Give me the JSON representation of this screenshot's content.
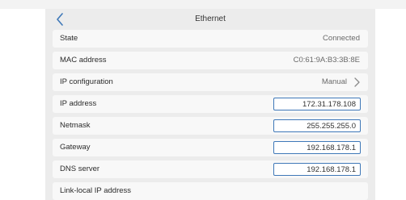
{
  "header": {
    "title": "Ethernet"
  },
  "rows": {
    "state": {
      "label": "State",
      "value": "Connected"
    },
    "mac": {
      "label": "MAC address",
      "value": "C0:61:9A:B3:3B:8E"
    },
    "ipconfig": {
      "label": "IP configuration",
      "value": "Manual"
    },
    "ip": {
      "label": "IP address",
      "value": "172.31.178.108"
    },
    "netmask": {
      "label": "Netmask",
      "value": "255.255.255.0"
    },
    "gateway": {
      "label": "Gateway",
      "value": "192.168.178.1"
    },
    "dns": {
      "label": "DNS server",
      "value": "192.168.178.1"
    },
    "linklocal": {
      "label": "Link-local IP address",
      "value": ""
    }
  },
  "colors": {
    "accent": "#3f78b8",
    "panel": "#ececec",
    "row": "#f8f8f8"
  },
  "icons": {
    "back": "chevron-left-icon",
    "ipconfig": "chevron-right-icon"
  }
}
